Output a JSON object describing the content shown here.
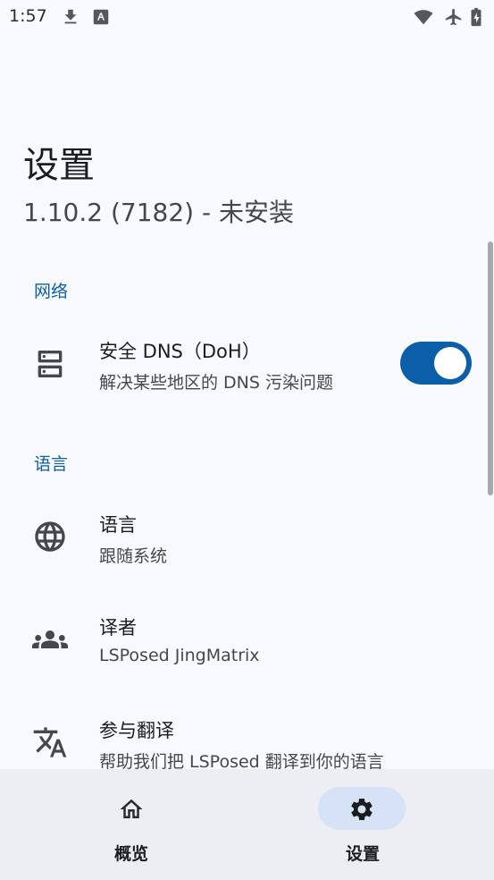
{
  "status_bar": {
    "time": "1:57",
    "icons": [
      "download-icon",
      "font-icon",
      "wifi-icon",
      "airplane-icon",
      "battery-icon"
    ]
  },
  "header": {
    "title": "设置",
    "subtitle": "1.10.2 (7182) - 未安装"
  },
  "sections": {
    "network": {
      "header": "网络",
      "doh": {
        "title": "安全 DNS（DoH）",
        "summary": "解决某些地区的 DNS 污染问题",
        "icon": "dns-icon",
        "enabled": true
      }
    },
    "language": {
      "header": "语言",
      "items": [
        {
          "title": "语言",
          "summary": "跟随系统",
          "icon": "globe-icon"
        },
        {
          "title": "译者",
          "summary": "LSPosed JingMatrix",
          "icon": "groups-icon"
        },
        {
          "title": "参与翻译",
          "summary": "帮助我们把 LSPosed 翻译到你的语言",
          "icon": "translate-icon"
        }
      ]
    }
  },
  "bottom_nav": {
    "items": [
      {
        "label": "概览",
        "icon": "home-icon",
        "active": false
      },
      {
        "label": "设置",
        "icon": "gear-icon",
        "active": true
      }
    ]
  },
  "colors": {
    "accent": "#0B5FA8",
    "background": "#F8F9FC",
    "nav_background": "#ECEEF3",
    "active_pill": "#D6E3F6"
  }
}
